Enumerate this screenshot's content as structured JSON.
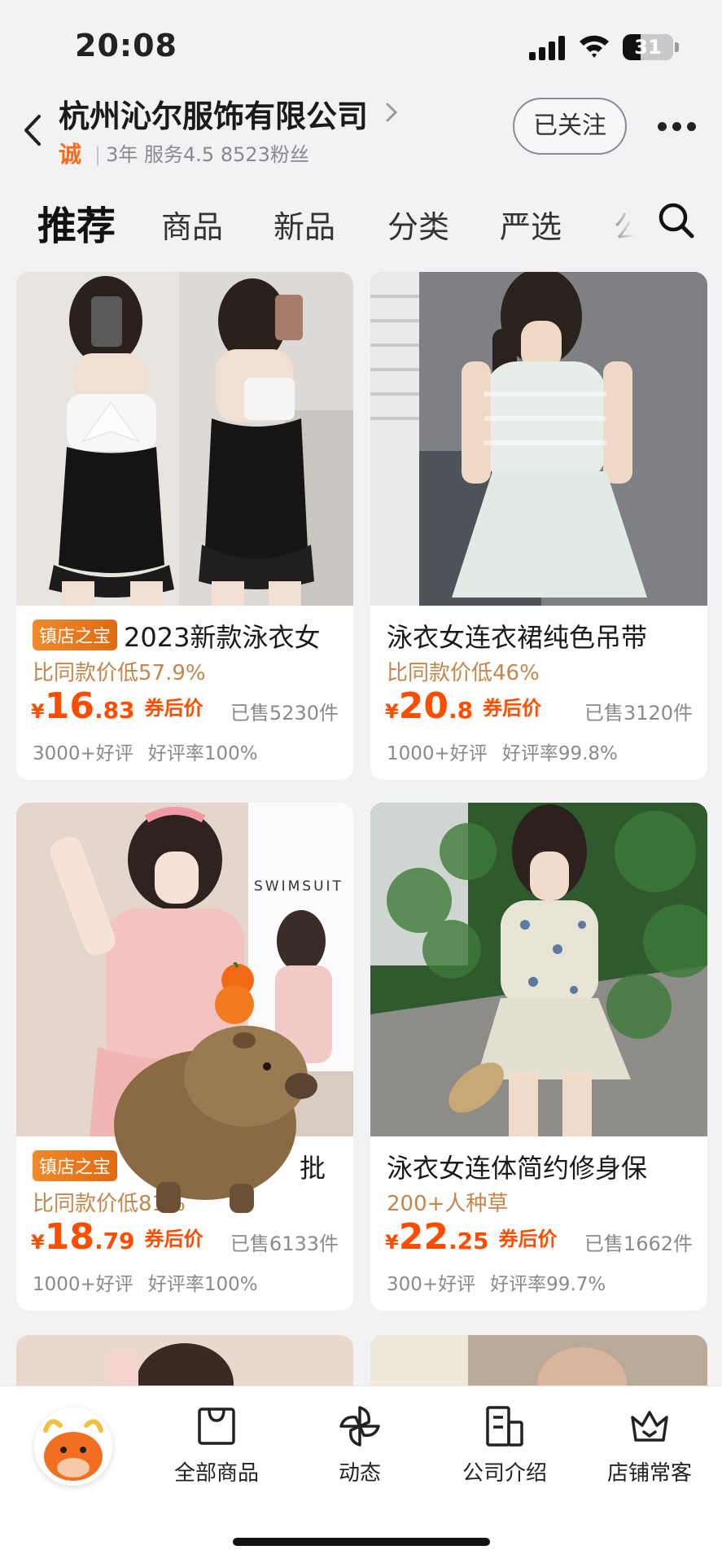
{
  "status": {
    "time": "20:08",
    "battery": "31"
  },
  "shop": {
    "name": "杭州沁尔服饰有限公司",
    "cheng_label": "诚",
    "years": "3年",
    "service": "服务4.5",
    "fans": "8523粉丝",
    "follow_label": "已关注"
  },
  "tabs": [
    "推荐",
    "商品",
    "新品",
    "分类",
    "严选",
    "公"
  ],
  "products": [
    {
      "badge": "镇店之宝",
      "title": "2023新款泳衣女",
      "sub": "比同款价低57.9%",
      "price_int": "16",
      "price_dec": ".83",
      "after": "券后价",
      "sold": "已售5230件",
      "good_reviews": "3000+好评",
      "rating": "好评率100%"
    },
    {
      "badge": "",
      "title": "泳衣女连衣裙纯色吊带",
      "sub": "比同款价低46%",
      "price_int": "20",
      "price_dec": ".8",
      "after": "券后价",
      "sold": "已售3120件",
      "good_reviews": "1000+好评",
      "rating": "好评率99.8%"
    },
    {
      "badge": "镇店之宝",
      "title": "批",
      "sub": "比同款价低81%",
      "price_int": "18",
      "price_dec": ".79",
      "after": "券后价",
      "sold": "已售6133件",
      "good_reviews": "1000+好评",
      "rating": "好评率100%",
      "photo_text": "SWIMSUIT"
    },
    {
      "badge": "",
      "title": "泳衣女连体简约修身保",
      "sub": "200+人种草",
      "price_int": "22",
      "price_dec": ".25",
      "after": "券后价",
      "sold": "已售1662件",
      "good_reviews": "300+好评",
      "rating": "好评率99.7%"
    }
  ],
  "currency": "¥",
  "bottom_nav": [
    {
      "label": "全部商品",
      "icon": "bag-icon"
    },
    {
      "label": "动态",
      "icon": "pinwheel-icon"
    },
    {
      "label": "公司介绍",
      "icon": "building-icon"
    },
    {
      "label": "店铺常客",
      "icon": "crown-icon"
    }
  ],
  "colors": {
    "price": "#ff4d00",
    "accent": "#ff6a1a",
    "sub_text": "#c3864a"
  }
}
